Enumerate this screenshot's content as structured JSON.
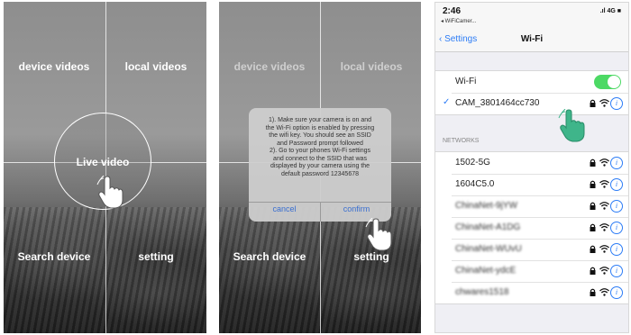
{
  "panel_a": {
    "quadrants": {
      "top_left": "device videos",
      "top_right": "local videos",
      "bottom_left": "Search device",
      "bottom_right": "setting"
    },
    "center_button": "Live video"
  },
  "panel_b": {
    "quadrants": {
      "top_left": "device videos",
      "top_right": "local videos",
      "bottom_left": "Search device",
      "bottom_right": "setting"
    },
    "dialog": {
      "lines": [
        "1). Make sure your camera is on and",
        "the Wi-Fi option is enabled by pressing",
        "the wifi key.  You should see an SSID",
        "and Password prompt followed",
        "2). Go to your phones Wi-Fi settings",
        "and connect to the SSID that was",
        "displayed by your camera using the",
        "default password 12345678"
      ],
      "cancel_label": "cancel",
      "confirm_label": "confirm"
    }
  },
  "panel_c": {
    "status_bar": {
      "time": "2:46",
      "back_app": "◂ WiFiCamer...",
      "signal": ".ıl 4G ■"
    },
    "nav": {
      "back_label": "Settings",
      "title": "Wi-Fi"
    },
    "wifi_toggle": {
      "label": "Wi-Fi",
      "on": true,
      "color": "#4cd964"
    },
    "connected_network": "CAM_3801464cc730",
    "section_header": "NETWORKS",
    "networks": [
      {
        "name": "1502-5G",
        "blurred": false
      },
      {
        "name": "1604C5.0",
        "blurred": false
      },
      {
        "name": "ChinaNet-9jYW",
        "blurred": true
      },
      {
        "name": "ChinaNet-A1DG",
        "blurred": true
      },
      {
        "name": "ChinaNet-WUvU",
        "blurred": true
      },
      {
        "name": "ChinaNet-ydcE",
        "blurred": true
      },
      {
        "name": "chwares1518",
        "blurred": true
      }
    ],
    "accent_color": "#2c7cf6",
    "info_glyph": "i"
  }
}
